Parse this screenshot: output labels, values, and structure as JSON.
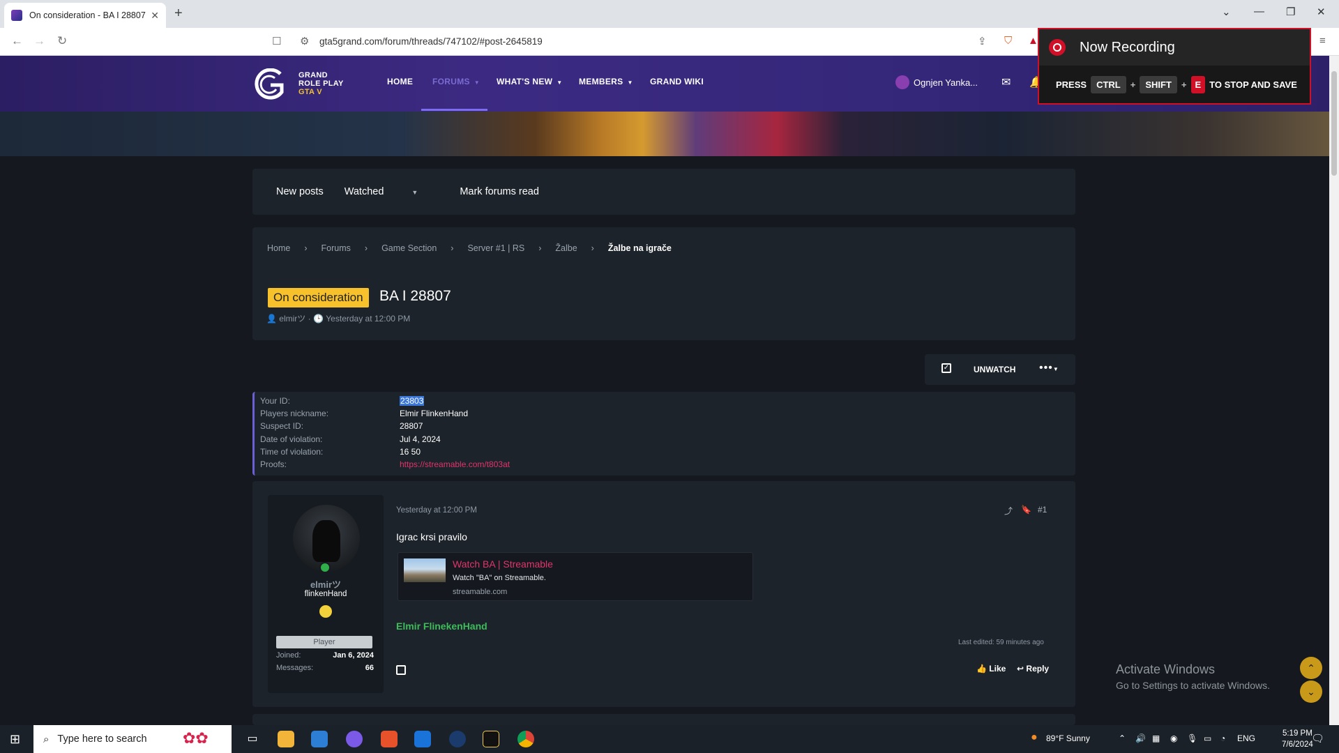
{
  "browser": {
    "tab_title": "On consideration - BA I 28807 |",
    "url": "gta5grand.com/forum/threads/747102/#post-2645819"
  },
  "site": {
    "logo_line1": "GRAND",
    "logo_line2": "ROLE PLAY",
    "logo_line3": "GTA V",
    "nav": [
      "HOME",
      "FORUMS",
      "WHAT'S NEW",
      "MEMBERS",
      "GRAND WIKI"
    ],
    "user_name": "Ognjen Yanka..."
  },
  "recording": {
    "title": "Now Recording",
    "press": "PRESS",
    "key1": "CTRL",
    "key2": "SHIFT",
    "key3": "E",
    "suffix": "TO STOP AND SAVE"
  },
  "subnav": {
    "new_posts": "New posts",
    "watched": "Watched",
    "mark_read": "Mark forums read"
  },
  "breadcrumbs": [
    "Home",
    "Forums",
    "Game Section",
    "Server #1 | RS",
    "Žalbe",
    "Žalbe na igrače"
  ],
  "thread": {
    "prefix": "On consideration",
    "title": "BA I 28807",
    "author": "elmirツ",
    "date": "Yesterday at 12:00 PM"
  },
  "actions": {
    "unwatch": "UNWATCH"
  },
  "report": {
    "fields": [
      {
        "label": "Your ID:",
        "value": "23803"
      },
      {
        "label": "Players nickname:",
        "value": "Elmir FlinkenHand"
      },
      {
        "label": "Suspect ID:",
        "value": "28807"
      },
      {
        "label": "Date of violation:",
        "value": "Jul 4, 2024"
      },
      {
        "label": "Time of violation:",
        "value": "16 50"
      },
      {
        "label": "Proofs:",
        "value": "https://streamable.com/t803at"
      }
    ]
  },
  "post": {
    "author_name": "elmirツ",
    "author_title": "flinkenHand",
    "role": "Player",
    "joined_label": "Joined:",
    "joined_value": "Jan 6, 2024",
    "messages_label": "Messages:",
    "messages_value": "66",
    "date": "Yesterday at 12:00 PM",
    "number": "#1",
    "text": "Igrac krsi pravilo",
    "embed_title": "Watch BA | Streamable",
    "embed_desc": "Watch \"BA\" on Streamable.",
    "embed_site": "streamable.com",
    "signature": "Elmir FlinekenHand",
    "edited": "Last edited: 59 minutes ago",
    "like": "Like",
    "reply": "Reply"
  },
  "windows": {
    "activate_title": "Activate Windows",
    "activate_sub": "Go to Settings to activate Windows.",
    "search_placeholder": "Type here to search",
    "weather": "89°F  Sunny",
    "lang": "ENG",
    "time": "5:19 PM",
    "date": "7/6/2024"
  },
  "colors": {
    "header": "#35277a",
    "prefix": "#f6c12a",
    "link": "#e0356a",
    "signature": "#3dbd5a",
    "recording": "#d01027"
  }
}
